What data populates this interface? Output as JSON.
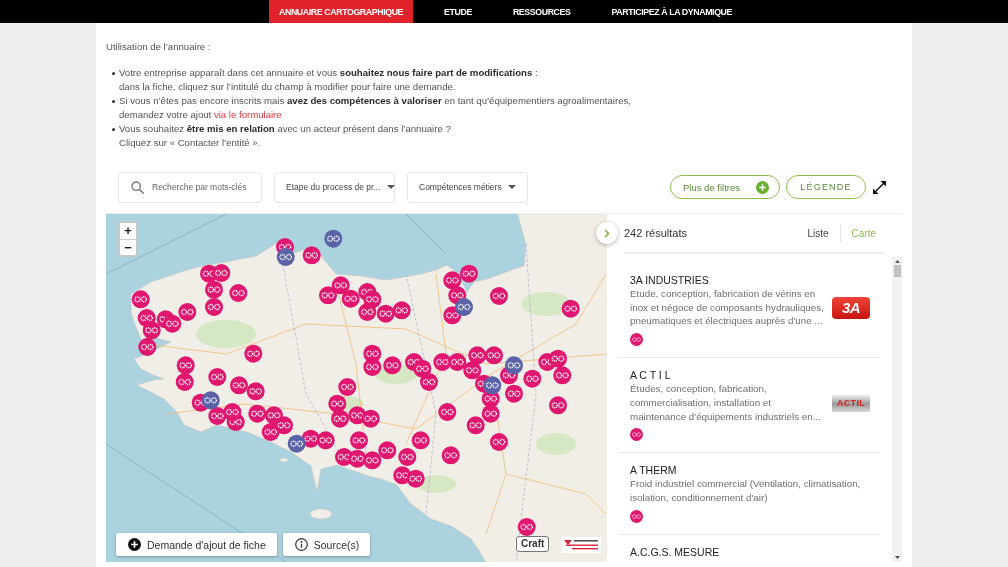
{
  "nav": {
    "tabs": [
      {
        "label": "ANNUAIRE CARTOGRAPHIQUE",
        "selected": true
      },
      {
        "label": "ETUDE",
        "selected": false
      },
      {
        "label": "RESSOURCES",
        "selected": false
      },
      {
        "label": "PARTICIPEZ À LA DYNAMIQUE",
        "selected": false
      }
    ]
  },
  "intro": {
    "heading": "Utilisation de l’annuaire :",
    "bullets": [
      {
        "text": "Votre entreprise apparaît dans cet annuaire et vous **souhaitez nous faire part de modifications** :\ndans la fiche, cliquez sur l’intitulé du champ à modifier pour faire une demande."
      },
      {
        "text": "Si vous n’êtes pas encore inscrits mais **avez des compétences à valoriser** en tant qu’équipementiers agroalimentaires,\ndemandez votre ajout ",
        "link": "via le formulaire"
      },
      {
        "text": "Vous souhaitez **être mis en relation** avec un acteur présent dans l’annuaire ?\nCliquez sur « Contacter l’entité »."
      }
    ]
  },
  "filters": {
    "search": {
      "placeholder": "Recherche par mots-clés"
    },
    "dropdowns": [
      {
        "label": "Etape du process de pr..."
      },
      {
        "label": "Compétences métiers"
      }
    ],
    "more_filters": "Plus de filtres",
    "legend": "LÉGENDE"
  },
  "map": {
    "zoom_in": "+",
    "zoom_out": "−",
    "add_button": "Demande d'ajout de fiche",
    "sources_button": "Source(s)",
    "credit": "Craft"
  },
  "results": {
    "count": "242 résultats",
    "views": [
      {
        "label": "Liste",
        "selected": false
      },
      {
        "label": "Carte",
        "selected": true
      }
    ],
    "items": [
      {
        "name": "3A INDUSTRIES",
        "description": "Etude, conception, fabrication de vérins en\ninox et négoce de composants hydrauliques,\npneumatiques et électriques auprès d'une ...",
        "logo": {
          "kind": "badge",
          "text": "3A"
        }
      },
      {
        "name": "A C T I L",
        "description": "Études, conception, fabrication,\ncommercialisation, installation et\nmaintenance d'équipements industriels en...",
        "logo": {
          "kind": "plate",
          "text": "ACTIL"
        }
      },
      {
        "name": "A THERM",
        "description": "Froid industriel commercial (Ventilation, climatisation,\nisolation, conditionnement d'air)"
      },
      {
        "name": "A.C.G.S. MESURE"
      }
    ]
  }
}
